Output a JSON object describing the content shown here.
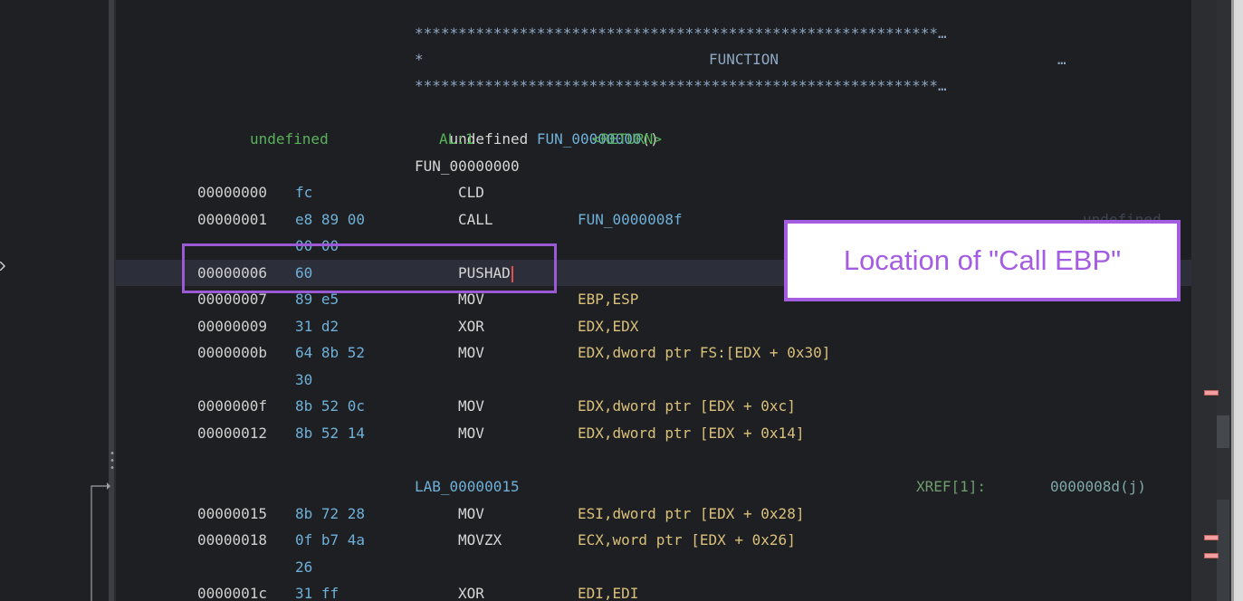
{
  "colors": {
    "background": "#1e1f22",
    "address": "#d0d0d0",
    "bytes": "#6fb0d8",
    "operand": "#d9c07a",
    "immediate": "#7fc27f",
    "label": "#6fb0d8",
    "type": "#59b15c",
    "annotation": "#a45ce0",
    "cursor": "#e05050"
  },
  "header": {
    "stars": "************************************************************…",
    "function_star": "*",
    "function_title": "FUNCTION",
    "function_ellipsis": "…",
    "signature_type": "undefined",
    "signature_name": "FUN_00000000",
    "signature_parens": "()",
    "return_type": "undefined",
    "return_storage": "AL:1",
    "return_name": "<RETURN>",
    "label": "FUN_00000000"
  },
  "rows": [
    {
      "addr": "00000000",
      "bytes": "fc",
      "mnemonic": "CLD",
      "op1": "",
      "op2": ""
    },
    {
      "addr": "00000001",
      "bytes": "e8 89 00",
      "mnemonic": "CALL",
      "op1": "FUN_0000008f",
      "op2": ""
    },
    {
      "addr": "",
      "bytes": "00 00",
      "mnemonic": "",
      "op1": "",
      "op2": ""
    },
    {
      "addr": "00000006",
      "bytes": "60",
      "mnemonic": "PUSHAD",
      "op1": "",
      "op2": ""
    },
    {
      "addr": "00000007",
      "bytes": "89 e5",
      "mnemonic": "MOV",
      "op1": "EBP,ESP",
      "op2": ""
    },
    {
      "addr": "00000009",
      "bytes": "31 d2",
      "mnemonic": "XOR",
      "op1": "EDX,EDX",
      "op2": ""
    },
    {
      "addr": "0000000b",
      "bytes": "64 8b 52",
      "mnemonic": "MOV",
      "op1": "EDX,dword ptr FS:[EDX + 0x30]",
      "op2": ""
    },
    {
      "addr": "",
      "bytes": "30",
      "mnemonic": "",
      "op1": "",
      "op2": ""
    },
    {
      "addr": "0000000f",
      "bytes": "8b 52 0c",
      "mnemonic": "MOV",
      "op1": "EDX,dword ptr [EDX + 0xc]",
      "op2": ""
    },
    {
      "addr": "00000012",
      "bytes": "8b 52 14",
      "mnemonic": "MOV",
      "op1": "EDX,dword ptr [EDX + 0x14]",
      "op2": ""
    }
  ],
  "lab": {
    "label": "LAB_00000015",
    "xref_label": "XREF[1]:",
    "xref_addr": "0000008d(j)"
  },
  "rows2": [
    {
      "addr": "00000015",
      "bytes": "8b 72 28",
      "mnemonic": "MOV",
      "op1": "ESI,dword ptr [EDX + 0x28]"
    },
    {
      "addr": "00000018",
      "bytes": "0f b7 4a",
      "mnemonic": "MOVZX",
      "op1": "ECX,word ptr [EDX + 0x26]"
    },
    {
      "addr": "",
      "bytes": "26",
      "mnemonic": "",
      "op1": ""
    },
    {
      "addr": "0000001c",
      "bytes": "31 ff",
      "mnemonic": "XOR",
      "op1": "EDI,EDI"
    }
  ],
  "hidden_text": "undefined",
  "callout": {
    "text": "Location of \"Call EBP\""
  }
}
